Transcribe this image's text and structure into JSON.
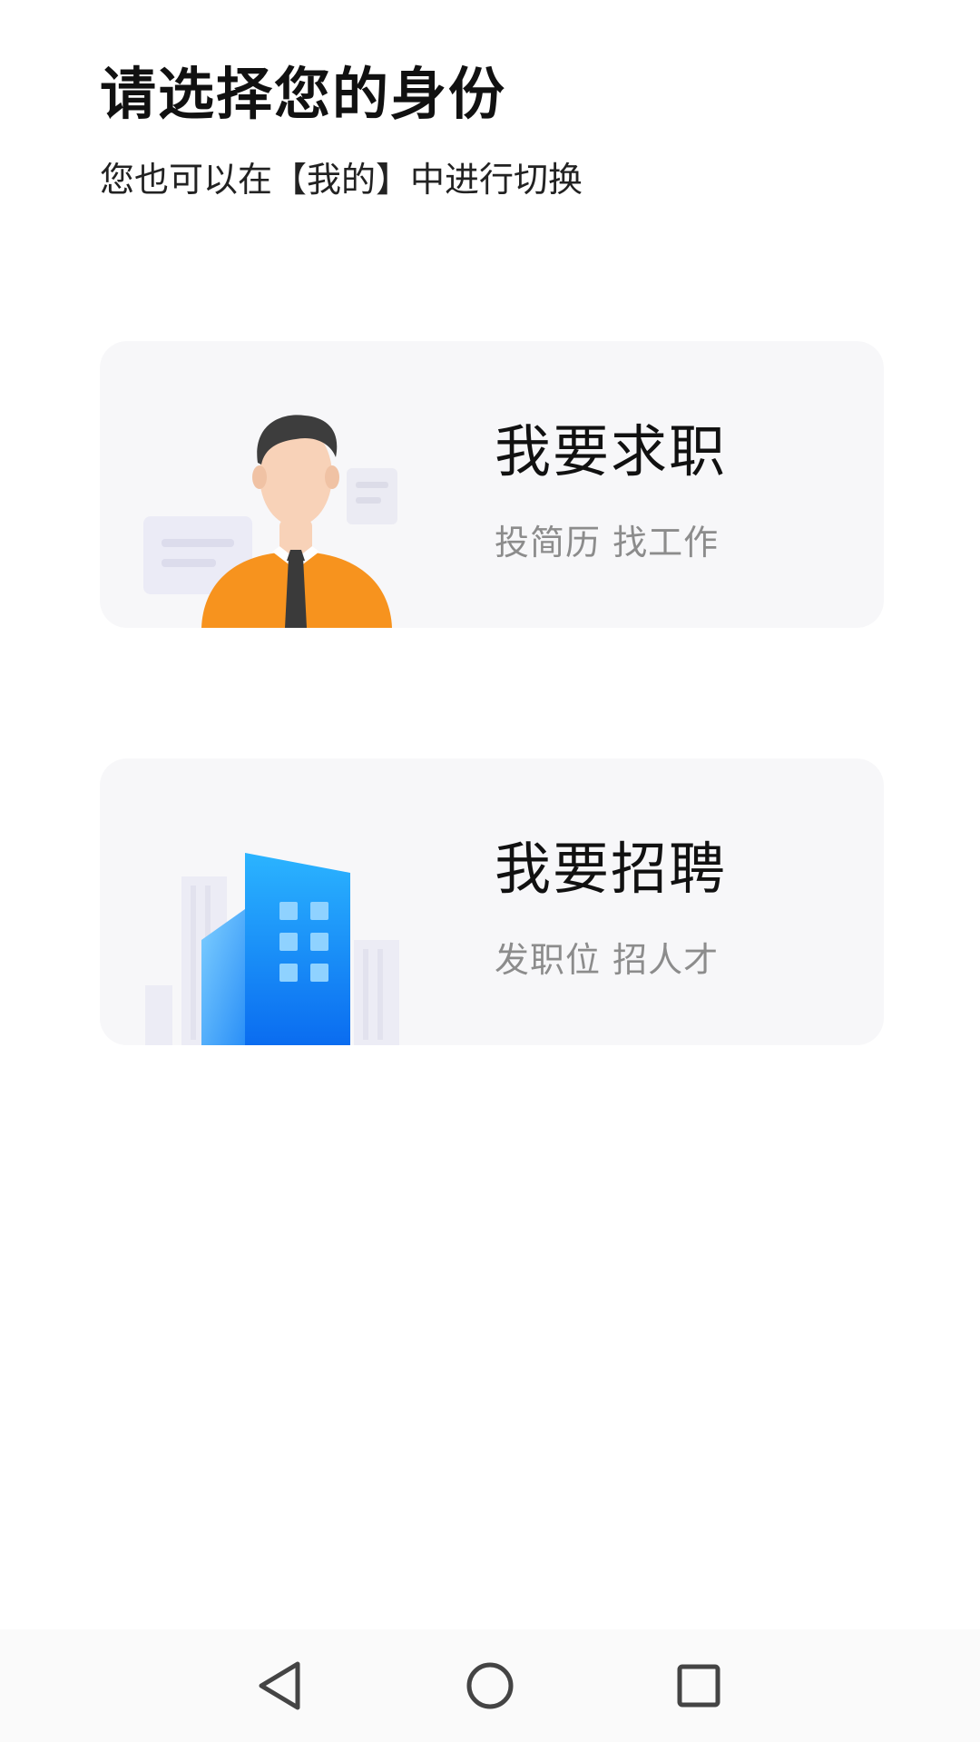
{
  "header": {
    "title": "请选择您的身份",
    "subtitle": "您也可以在【我的】中进行切换"
  },
  "options": [
    {
      "title": "我要求职",
      "description": "投简历 找工作",
      "illustration": "job-seeker-illustration",
      "accent": "#f7931e"
    },
    {
      "title": "我要招聘",
      "description": "发职位 招人才",
      "illustration": "office-building-illustration",
      "accent": "#1e90ff"
    }
  ],
  "navbar": {
    "back_icon": "triangle-back-icon",
    "home_icon": "circle-home-icon",
    "recent_icon": "square-recent-icon"
  }
}
